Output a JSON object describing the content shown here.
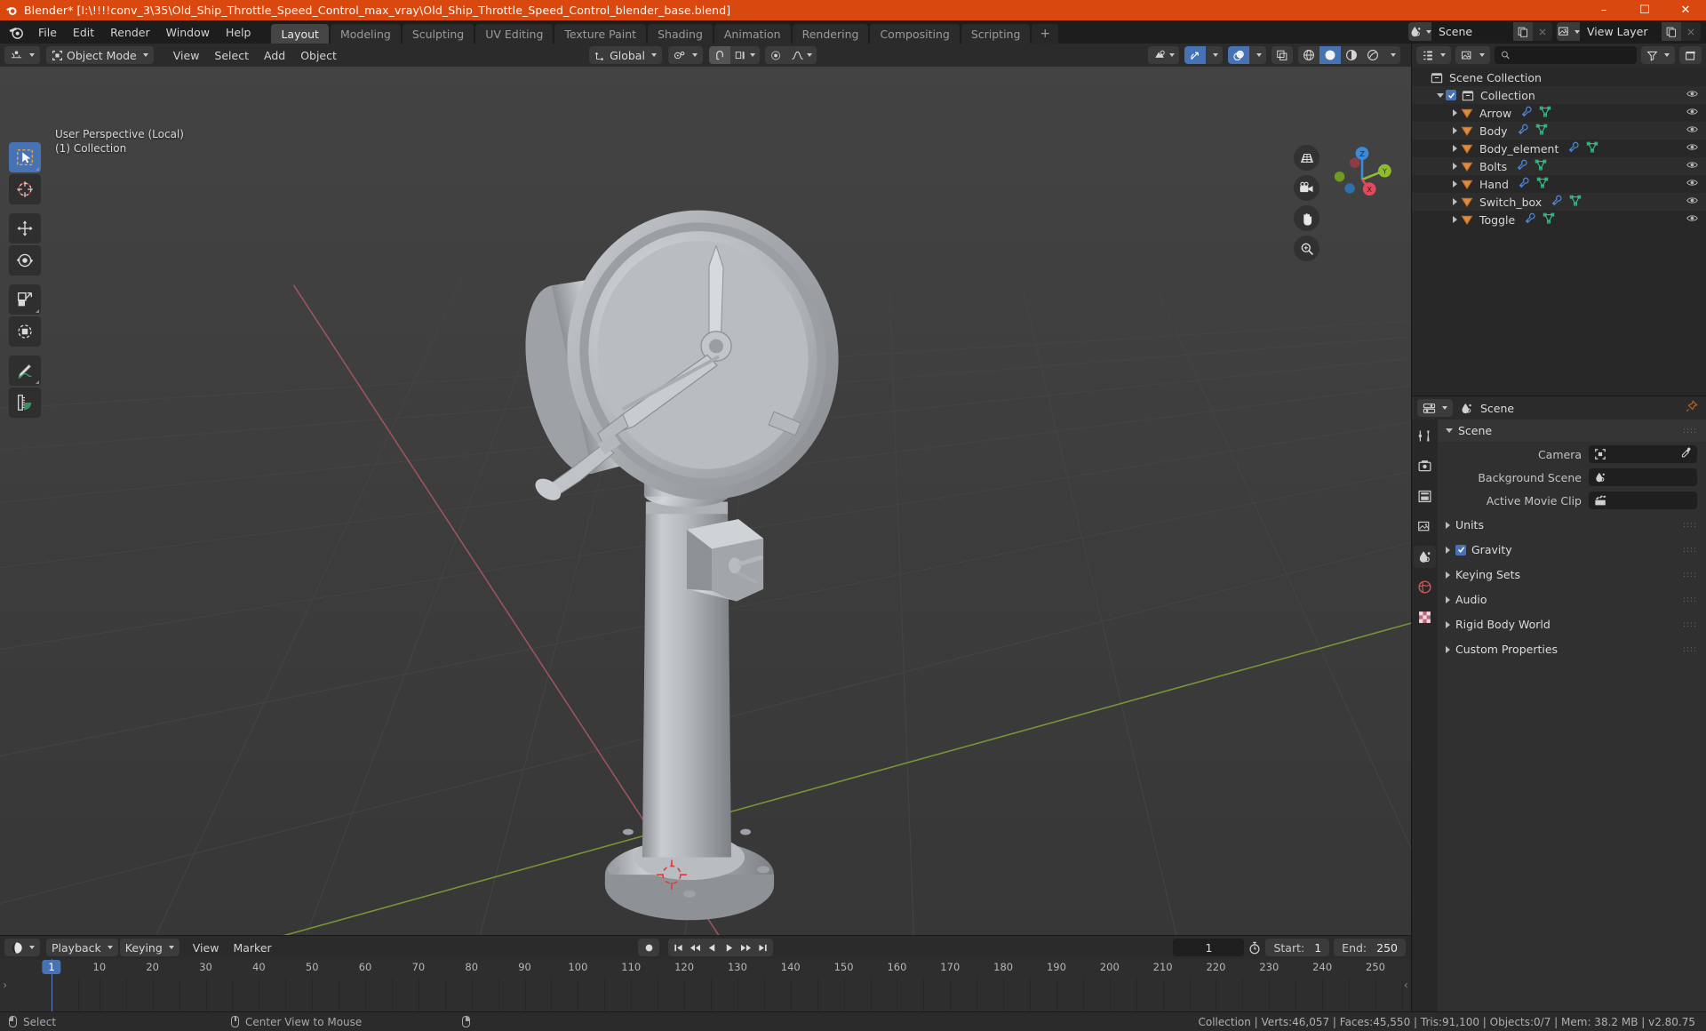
{
  "titlebar": {
    "text": "Blender* [I:\\!!!!conv_3\\35\\Old_Ship_Throttle_Speed_Control_max_vray\\Old_Ship_Throttle_Speed_Control_blender_base.blend]",
    "minimize": "–",
    "maximize": "☐",
    "close": "✕",
    "accent": "#d9480f"
  },
  "topbar": {
    "menus": [
      "File",
      "Edit",
      "Render",
      "Window",
      "Help"
    ],
    "workspaces": [
      {
        "label": "Layout",
        "active": true
      },
      {
        "label": "Modeling",
        "active": false
      },
      {
        "label": "Sculpting",
        "active": false
      },
      {
        "label": "UV Editing",
        "active": false
      },
      {
        "label": "Texture Paint",
        "active": false
      },
      {
        "label": "Shading",
        "active": false
      },
      {
        "label": "Animation",
        "active": false
      },
      {
        "label": "Rendering",
        "active": false
      },
      {
        "label": "Compositing",
        "active": false
      },
      {
        "label": "Scripting",
        "active": false
      }
    ],
    "add_workspace": "+",
    "scene_name": "Scene",
    "view_layer_name": "View Layer"
  },
  "viewport_header": {
    "mode": "Object Mode",
    "menus": [
      "View",
      "Select",
      "Add",
      "Object"
    ],
    "transform_orientation": "Global"
  },
  "viewport": {
    "overlay_line1": "User Perspective (Local)",
    "overlay_line2": "(1) Collection",
    "gizmo_axes": [
      "X",
      "Y",
      "Z"
    ],
    "tools": [
      {
        "name": "tweak-select-box",
        "active": true
      },
      {
        "name": "cursor",
        "active": false
      },
      {
        "name": "move",
        "active": false
      },
      {
        "name": "rotate",
        "active": false
      },
      {
        "name": "scale",
        "active": false
      },
      {
        "name": "transform",
        "active": false
      },
      {
        "name": "annotate",
        "active": false
      },
      {
        "name": "measure",
        "active": false
      }
    ],
    "nav_icons": [
      "grid-icon",
      "camera-icon",
      "hand-icon",
      "zoom-icon"
    ],
    "axis_colors": {
      "x": "#e04a5c",
      "y": "#8fbc2e",
      "z": "#3d8ad6"
    }
  },
  "timeline": {
    "editor_menus": [
      "Playback",
      "Keying",
      "View",
      "Marker"
    ],
    "current_frame": "1",
    "start_label": "Start:",
    "start_value": "1",
    "end_label": "End:",
    "end_value": "250",
    "ruler_ticks": [
      "1",
      "10",
      "20",
      "30",
      "40",
      "50",
      "60",
      "70",
      "80",
      "90",
      "100",
      "110",
      "120",
      "130",
      "140",
      "150",
      "160",
      "170",
      "180",
      "190",
      "200",
      "210",
      "220",
      "230",
      "240",
      "250"
    ],
    "playhead_label": "1",
    "left_arrow": "›",
    "right_arrow": "‹"
  },
  "outliner": {
    "search_placeholder": "",
    "rows": [
      {
        "label": "Scene Collection",
        "indent": 0,
        "icon": "collection-icon",
        "expand": false,
        "checkbox": false,
        "eye": false,
        "mods": []
      },
      {
        "label": "Collection",
        "indent": 1,
        "icon": "collection-icon",
        "expand": true,
        "checkbox": true,
        "eye": true,
        "mods": []
      },
      {
        "label": "Arrow",
        "indent": 2,
        "icon": "mesh-object-icon",
        "expand": true,
        "checkbox": false,
        "eye": true,
        "mods": [
          "wrench-icon",
          "mesh-data-icon"
        ]
      },
      {
        "label": "Body",
        "indent": 2,
        "icon": "mesh-object-icon",
        "expand": true,
        "checkbox": false,
        "eye": true,
        "mods": [
          "wrench-icon",
          "mesh-data-icon"
        ]
      },
      {
        "label": "Body_element",
        "indent": 2,
        "icon": "mesh-object-icon",
        "expand": true,
        "checkbox": false,
        "eye": true,
        "mods": [
          "wrench-icon",
          "mesh-data-icon"
        ]
      },
      {
        "label": "Bolts",
        "indent": 2,
        "icon": "mesh-object-icon",
        "expand": true,
        "checkbox": false,
        "eye": true,
        "mods": [
          "wrench-icon",
          "mesh-data-icon"
        ]
      },
      {
        "label": "Hand",
        "indent": 2,
        "icon": "mesh-object-icon",
        "expand": true,
        "checkbox": false,
        "eye": true,
        "mods": [
          "wrench-icon",
          "mesh-data-icon"
        ]
      },
      {
        "label": "Switch_box",
        "indent": 2,
        "icon": "mesh-object-icon",
        "expand": true,
        "checkbox": false,
        "eye": true,
        "mods": [
          "wrench-icon",
          "mesh-data-icon"
        ]
      },
      {
        "label": "Toggle",
        "indent": 2,
        "icon": "mesh-object-icon",
        "expand": true,
        "checkbox": false,
        "eye": true,
        "mods": [
          "wrench-icon",
          "mesh-data-icon"
        ]
      }
    ]
  },
  "properties": {
    "breadcrumb": "Scene",
    "tabs": [
      "tool-icon",
      "render-icon",
      "output-icon",
      "view-layer-icon",
      "scene-icon",
      "world-icon",
      "texture-icon"
    ],
    "active_tab_index": 4,
    "scene_panel": {
      "title": "Scene",
      "camera_label": "Camera",
      "camera_value": "",
      "background_scene_label": "Background Scene",
      "background_scene_value": "",
      "active_movie_clip_label": "Active Movie Clip",
      "active_movie_clip_value": ""
    },
    "panels": [
      {
        "label": "Units",
        "checkbox": false,
        "open": false
      },
      {
        "label": "Gravity",
        "checkbox": true,
        "open": false
      },
      {
        "label": "Keying Sets",
        "checkbox": false,
        "open": false
      },
      {
        "label": "Audio",
        "checkbox": false,
        "open": false
      },
      {
        "label": "Rigid Body World",
        "checkbox": false,
        "open": false
      },
      {
        "label": "Custom Properties",
        "checkbox": false,
        "open": false
      }
    ]
  },
  "statusbar": {
    "hints": [
      {
        "mouse": "left",
        "label": "Select"
      },
      {
        "mouse": "middle",
        "label": "Center View to Mouse"
      },
      {
        "mouse": "right",
        "label": ""
      }
    ],
    "stats": "Collection | Verts:46,057 | Faces:45,550 | Tris:91,100 | Objects:0/7 | Mem: 38.2 MB | v2.80.75"
  }
}
